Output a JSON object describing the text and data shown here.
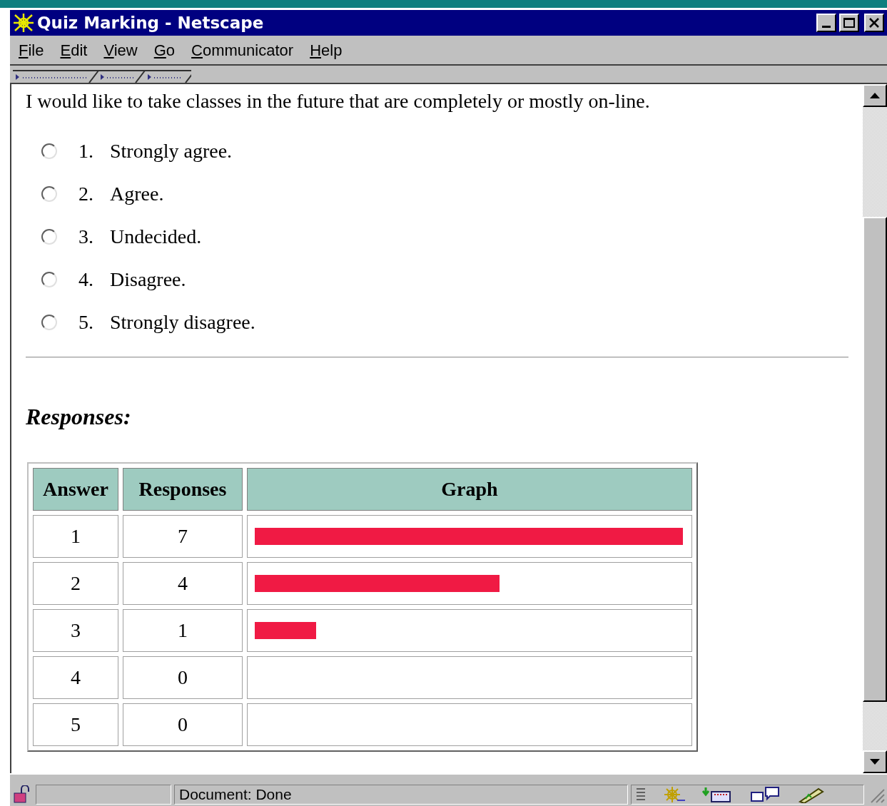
{
  "window": {
    "title": "Quiz Marking - Netscape"
  },
  "menu": [
    "File",
    "Edit",
    "View",
    "Go",
    "Communicator",
    "Help"
  ],
  "question": "I would like to take classes in the future that are completely or mostly on-line.",
  "options": [
    {
      "number": "1.",
      "label": "Strongly agree.",
      "selected": false
    },
    {
      "number": "2.",
      "label": "Agree.",
      "selected": false
    },
    {
      "number": "3.",
      "label": "Undecided.",
      "selected": false
    },
    {
      "number": "4.",
      "label": "Disagree.",
      "selected": false
    },
    {
      "number": "5.",
      "label": "Strongly disagree.",
      "selected": false
    }
  ],
  "responses_heading": "Responses:",
  "table": {
    "columns": [
      "Answer",
      "Responses",
      "Graph"
    ],
    "rows": [
      {
        "answer": "1",
        "responses": "7"
      },
      {
        "answer": "2",
        "responses": "4"
      },
      {
        "answer": "3",
        "responses": "1"
      },
      {
        "answer": "4",
        "responses": "0"
      },
      {
        "answer": "5",
        "responses": "0"
      }
    ]
  },
  "status_bar": {
    "text": "Document: Done"
  }
}
